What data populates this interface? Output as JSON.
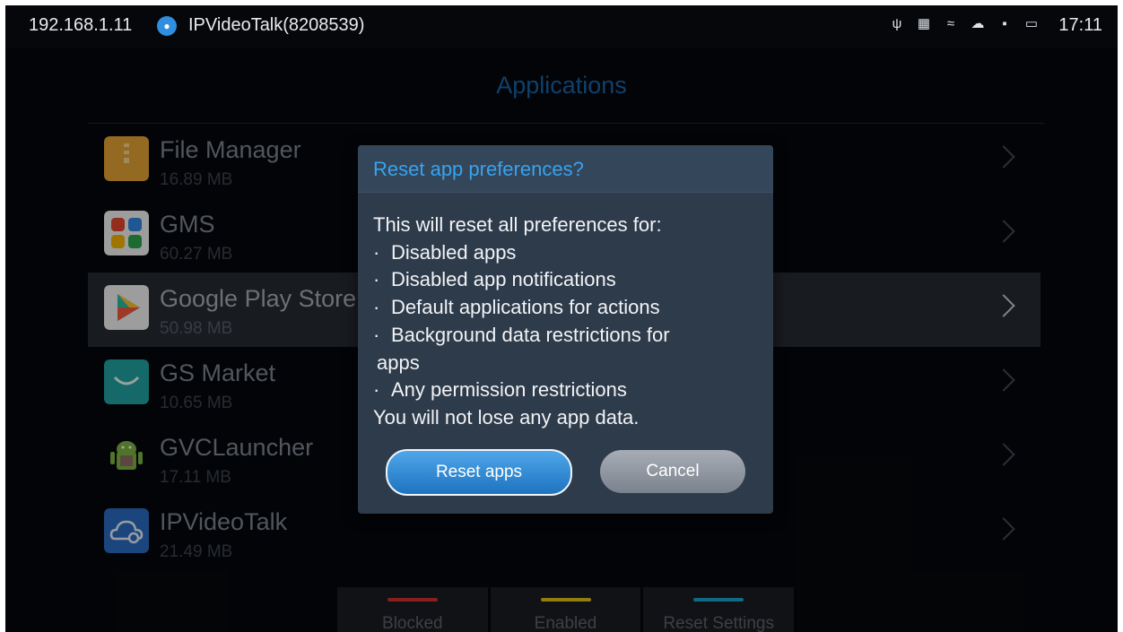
{
  "status_bar": {
    "ip": "192.168.1.11",
    "account_icon": "person-icon",
    "account_name": "IPVideoTalk(8208539)",
    "icons": [
      "usb-icon",
      "screenshot-icon",
      "wifi-off-icon",
      "cloud-icon",
      "sd-card-icon",
      "display-icon"
    ],
    "time": "17:11"
  },
  "page": {
    "title": "Applications"
  },
  "apps": [
    {
      "name": "File Manager",
      "size": "16.89 MB",
      "icon": "folder-icon",
      "color": "#e3a233",
      "selected": false
    },
    {
      "name": "GMS",
      "size": "60.27 MB",
      "icon": "google-apps-icon",
      "color": "#f1f1f1",
      "selected": false
    },
    {
      "name": "Google Play Store",
      "size": "50.98 MB",
      "icon": "play-store-icon",
      "color": "#f2f2f2",
      "selected": true
    },
    {
      "name": "GS Market",
      "size": "10.65 MB",
      "icon": "market-bag-icon",
      "color": "#22a2a1",
      "selected": false
    },
    {
      "name": "GVCLauncher",
      "size": "17.11 MB",
      "icon": "android-icon",
      "color": "#7cb342",
      "selected": false
    },
    {
      "name": "IPVideoTalk",
      "size": "21.49 MB",
      "icon": "cloud-video-icon",
      "color": "#2a6cc0",
      "selected": false
    }
  ],
  "bottom_bar": [
    {
      "label": "Blocked",
      "color": "#d32f2f"
    },
    {
      "label": "Enabled",
      "color": "#e0c11a"
    },
    {
      "label": "Reset Settings",
      "color": "#1aa3c9"
    }
  ],
  "dialog": {
    "title": "Reset app preferences?",
    "intro": "This will reset all preferences for:",
    "bullets": [
      "Disabled apps",
      "Disabled app notifications",
      "Default applications for actions",
      "Background data restrictions for",
      "Any permission restrictions"
    ],
    "continuation": "apps",
    "footer": "You will not lose any app data.",
    "confirm_label": "Reset apps",
    "cancel_label": "Cancel"
  }
}
